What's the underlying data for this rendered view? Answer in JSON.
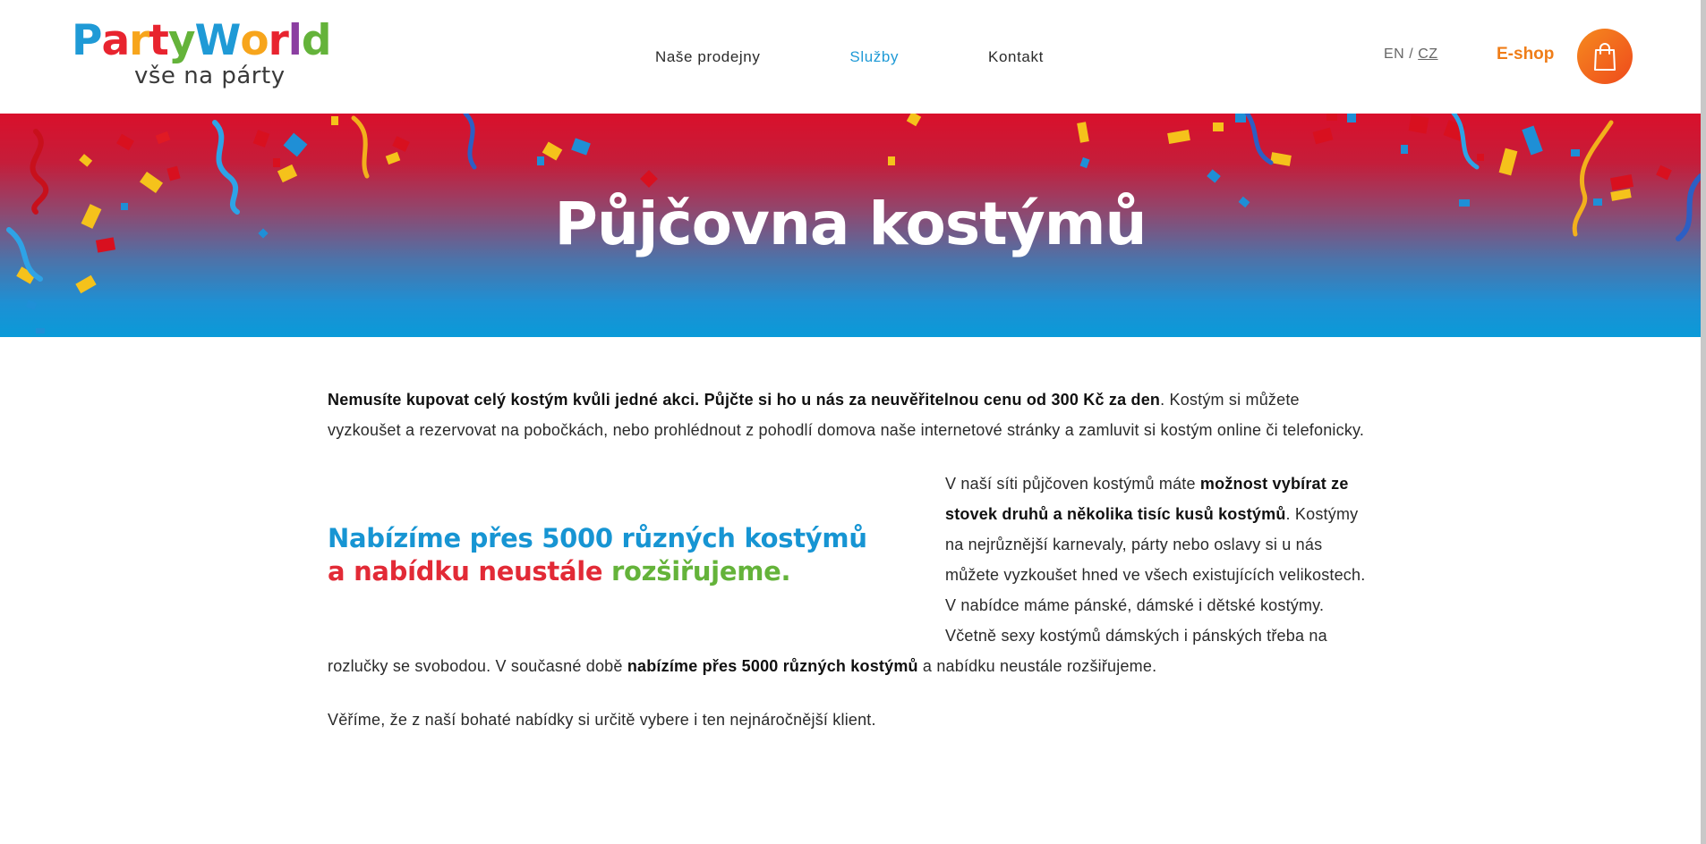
{
  "brand": {
    "logo_letters": [
      {
        "ch": "P",
        "color": "#1f9ad6"
      },
      {
        "ch": "a",
        "color": "#e8242f"
      },
      {
        "ch": "r",
        "color": "#f7a51c"
      },
      {
        "ch": "t",
        "color": "#e8242f"
      },
      {
        "ch": "y",
        "color": "#64b33a"
      },
      {
        "ch": "W",
        "color": "#1f9ad6"
      },
      {
        "ch": "o",
        "color": "#f7a51c"
      },
      {
        "ch": "r",
        "color": "#e8242f"
      },
      {
        "ch": "l",
        "color": "#8b3ea1"
      },
      {
        "ch": "d",
        "color": "#64b33a"
      }
    ],
    "tagline": "vše na párty"
  },
  "nav": {
    "items": [
      {
        "label": "Naše prodejny",
        "active": false
      },
      {
        "label": "Služby",
        "active": true
      },
      {
        "label": "Kontakt",
        "active": false
      }
    ]
  },
  "lang": {
    "en": "EN",
    "separator": "/",
    "cz": "CZ"
  },
  "eshop": {
    "label": "E-shop"
  },
  "cart": {
    "icon": "shopping-bag-icon"
  },
  "banner": {
    "title": "Půjčovna kostýmů"
  },
  "content": {
    "p1_bold": "Nemusíte kupovat celý kostým kvůli jedné akci. Půjčte si ho u nás za neuvěřitelnou cenu od 300 Kč za den",
    "p1_rest": ". Kostým si můžete vyzkoušet a rezervovat na pobočkách, nebo prohlédnout z pohodlí domova naše internetové stránky a zamluvit si kostým online či telefonicky.",
    "highlight_blue": "Nabízíme přes 5000 různých kostýmů",
    "highlight_red": "a nabídku neustále ",
    "highlight_green": "rozšiřujeme.",
    "p2_a": "V naší síti půjčoven kostýmů máte ",
    "p2_b": "možnost vybírat ze stovek druhů a několika tisíc kusů kostýmů",
    "p2_c": ". Kostýmy na nejrůznější karnevaly, párty nebo oslavy si u nás můžete vyzkoušet hned ve všech existujících velikostech. V nabídce máme pánské, dámské i dětské kostýmy. Včetně sexy kostýmů dámských i pánských třeba na rozlučky se svobodou. V současné době ",
    "p2_d": "nabízíme přes 5000 různých kostýmů",
    "p2_e": " a nabídku neustále rozšiřujeme.",
    "p3": "Věříme, že z naší bohaté nabídky si určitě vybere i ten nejnáročnější klient."
  },
  "colors": {
    "accent_blue": "#1f9ad6",
    "accent_red": "#e22a36",
    "accent_green": "#64b33a",
    "accent_orange": "#ef7d18"
  }
}
